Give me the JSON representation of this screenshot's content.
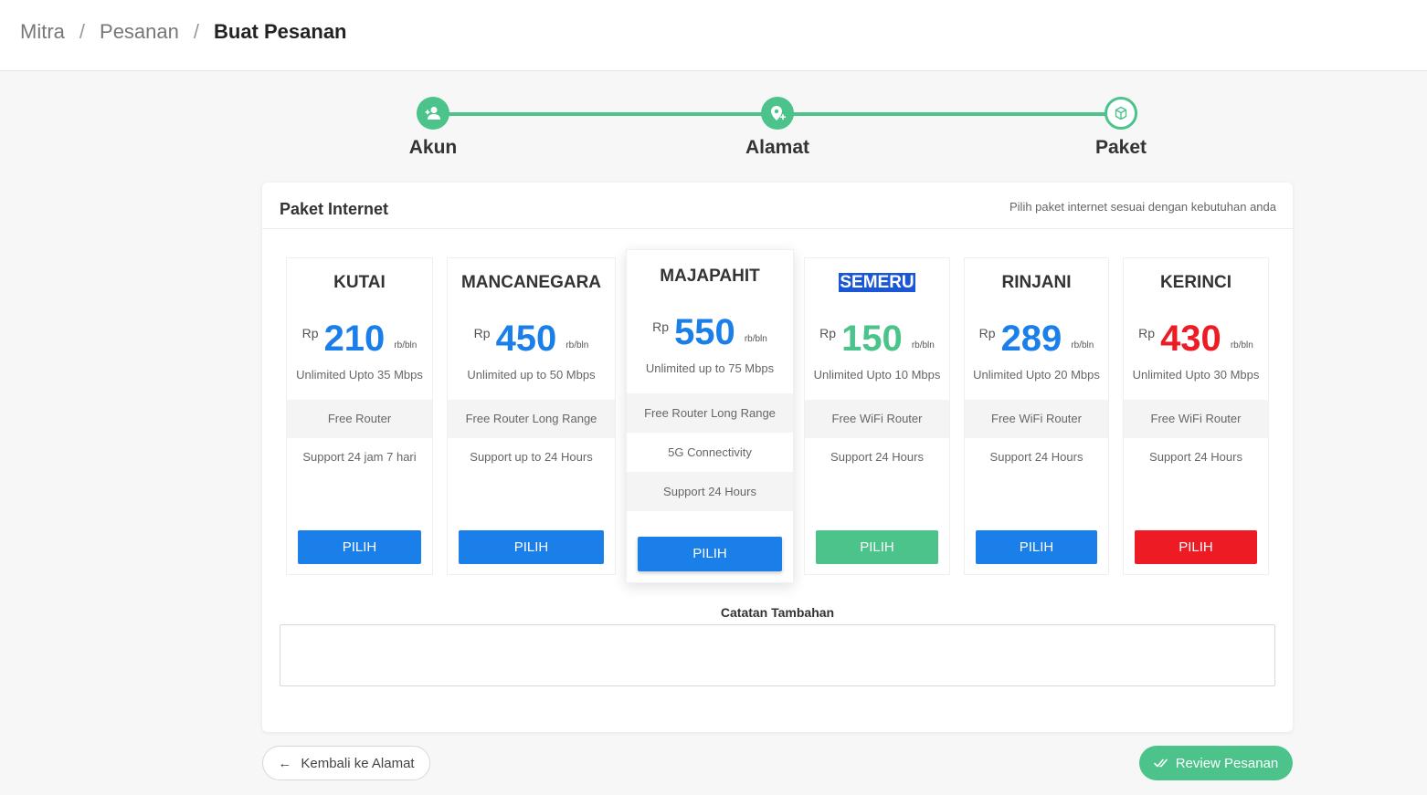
{
  "breadcrumb": {
    "items": [
      "Mitra",
      "Pesanan"
    ],
    "separator": "/",
    "current": "Buat Pesanan"
  },
  "stepper": {
    "steps": [
      {
        "label": "Akun",
        "icon": "user-plus-icon",
        "state": "done"
      },
      {
        "label": "Alamat",
        "icon": "map-pin-plus-icon",
        "state": "done"
      },
      {
        "label": "Paket",
        "icon": "box-icon",
        "state": "active"
      }
    ]
  },
  "card": {
    "title": "Paket Internet",
    "subtitle": "Pilih paket internet sesuai dengan kebutuhan anda"
  },
  "packages": [
    {
      "name": "KUTAI",
      "currency": "Rp",
      "price": "210",
      "unit": "rb/bln",
      "speed": "Unlimited Upto 35 Mbps",
      "features": [
        "Free Router",
        "Support 24 jam 7 hari"
      ],
      "button": "PILIH",
      "color": "#1a7fe8"
    },
    {
      "name": "MANCANEGARA",
      "currency": "Rp",
      "price": "450",
      "unit": "rb/bln",
      "speed": "Unlimited up to 50 Mbps",
      "features": [
        "Free Router Long Range",
        "Support up to 24 Hours"
      ],
      "button": "PILIH",
      "color": "#1a7fe8"
    },
    {
      "name": "MAJAPAHIT",
      "currency": "Rp",
      "price": "550",
      "unit": "rb/bln",
      "speed": "Unlimited up to 75 Mbps",
      "features": [
        "Free Router Long Range",
        "5G Connectivity",
        "Support 24 Hours"
      ],
      "button": "PILIH",
      "color": "#1a7fe8",
      "featured": true
    },
    {
      "name": "SEMERU",
      "currency": "Rp",
      "price": "150",
      "unit": "rb/bln",
      "speed": "Unlimited Upto 10 Mbps",
      "features": [
        "Free WiFi Router",
        "Support 24 Hours"
      ],
      "button": "PILIH",
      "color": "#4bc38a",
      "selected_text": true
    },
    {
      "name": "RINJANI",
      "currency": "Rp",
      "price": "289",
      "unit": "rb/bln",
      "speed": "Unlimited Upto 20 Mbps",
      "features": [
        "Free WiFi Router",
        "Support 24 Hours"
      ],
      "button": "PILIH",
      "color": "#1a7fe8"
    },
    {
      "name": "KERINCI",
      "currency": "Rp",
      "price": "430",
      "unit": "rb/bln",
      "speed": "Unlimited Upto 30 Mbps",
      "features": [
        "Free WiFi Router",
        "Support 24 Hours"
      ],
      "button": "PILIH",
      "color": "#ed1c24"
    }
  ],
  "notes": {
    "label": "Catatan Tambahan",
    "value": ""
  },
  "footer": {
    "back_label": "Kembali ke Alamat",
    "review_label": "Review Pesanan"
  },
  "colors": {
    "accent_green": "#4bc38a",
    "primary_blue": "#1a7fe8",
    "danger_red": "#ed1c24"
  }
}
